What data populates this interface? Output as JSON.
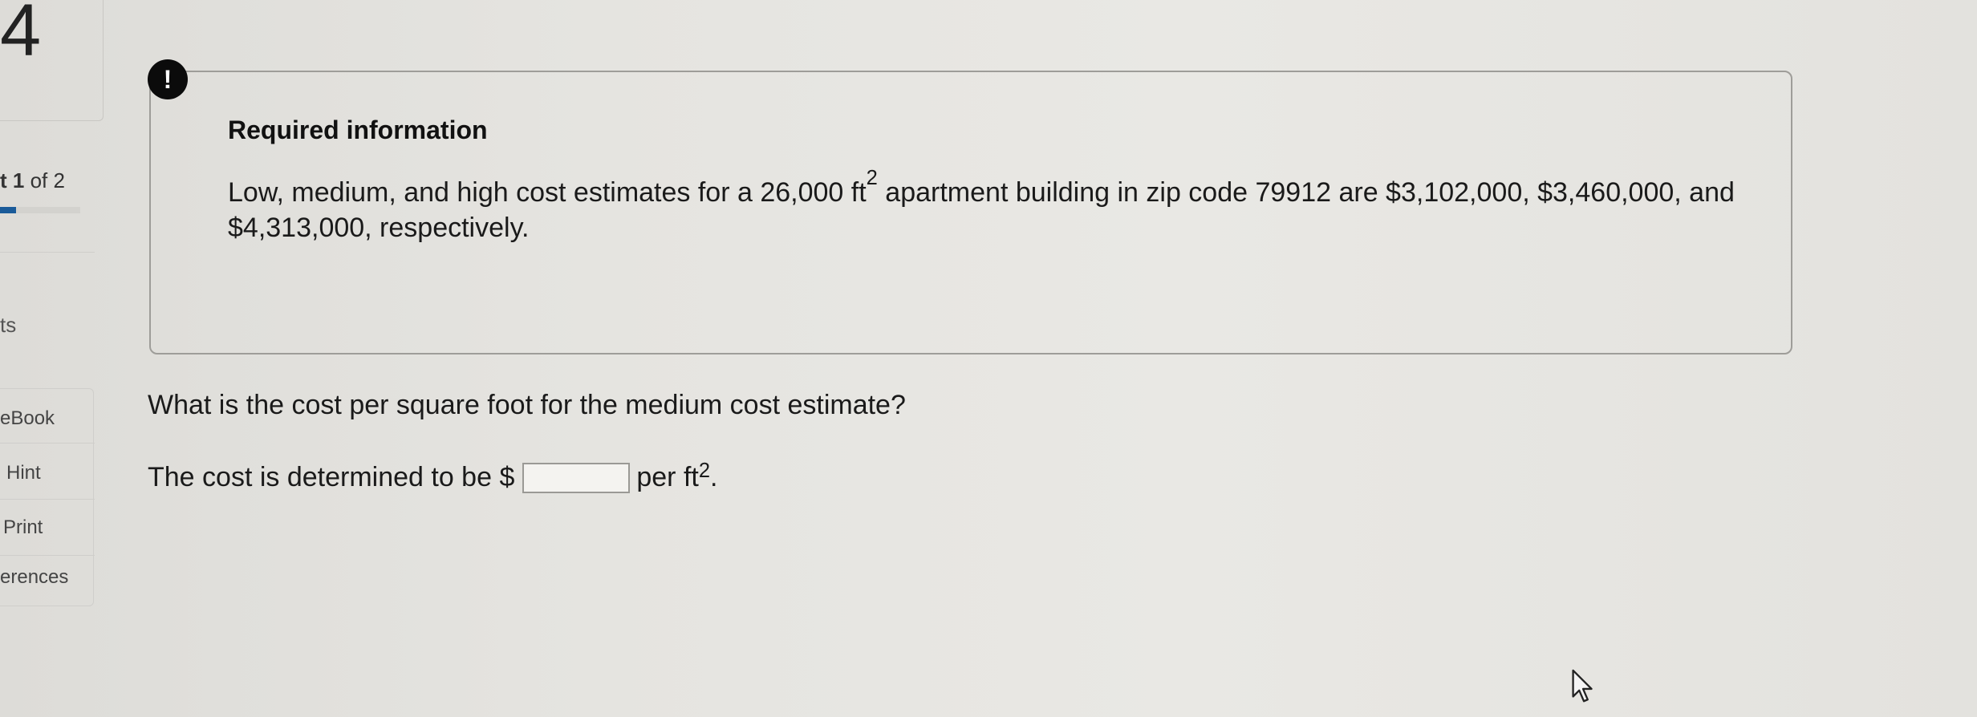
{
  "sidebar": {
    "question_number": "4",
    "part_prefix": "t",
    "part_current": "1",
    "part_suffix": " of 2",
    "part_progress_fraction": 0.5,
    "points_label": "ts",
    "links": [
      {
        "label": "eBook"
      },
      {
        "label": "Hint"
      },
      {
        "label": "Print"
      },
      {
        "label": "erences"
      }
    ]
  },
  "info": {
    "badge": "!",
    "title": "Required information",
    "text_part1": "Low, medium, and high cost estimates for a 26,000 ft",
    "text_sup": "2",
    "text_part2": " apartment building in zip code 79912 are $3,102,000, $3,460,000, and $4,313,000, respectively."
  },
  "question": {
    "text": "What is the cost per square foot for the medium cost estimate?",
    "answer_prefix": "The cost is determined to be $",
    "answer_value": "",
    "answer_suffix": "per ft",
    "answer_suffix_sup": "2",
    "answer_end": "."
  },
  "cursor": {
    "icon": "mouse-pointer-icon"
  }
}
